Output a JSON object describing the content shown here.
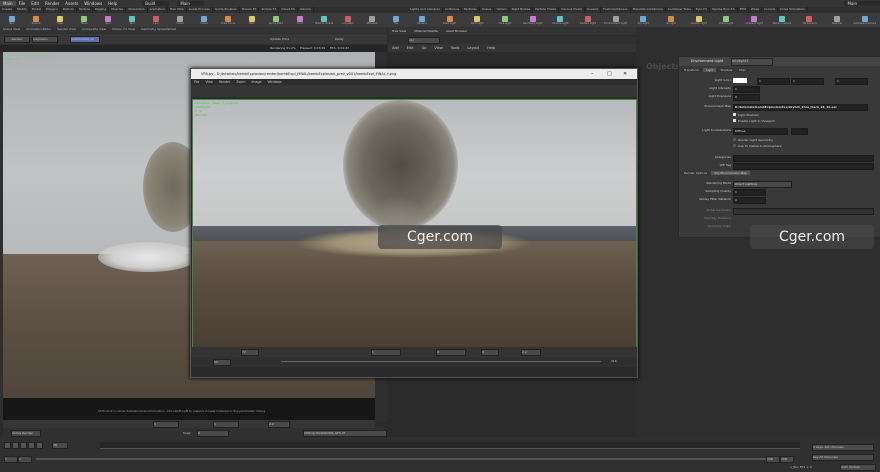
{
  "menubar": {
    "items": [
      "Main",
      "File",
      "Edit",
      "Render",
      "Assets",
      "Windows",
      "Help",
      "Build",
      "Main"
    ],
    "desktop": "Main"
  },
  "shelf": {
    "tabs": [
      "Create",
      "Modify",
      "Model",
      "Polygon",
      "Deform",
      "Texture",
      "Rigging",
      "Muscles",
      "Characters",
      "Animation",
      "Hair Utils",
      "Guide Process",
      "Guide Brushes",
      "Terrain FX",
      "Simple FX",
      "Cloud FX",
      "Volume"
    ],
    "tools": [
      "Box",
      "Sphere",
      "Tube",
      "Torus",
      "Grid",
      "Null",
      "Line",
      "Circle",
      "Curve",
      "Draw Curve",
      "Path",
      "Spray Paint",
      "Font",
      "Platonic Solids",
      "L-System",
      "Metaball",
      "File"
    ]
  },
  "lights_shelf": {
    "tabs": [
      "Lights and Cameras",
      "Collisions",
      "Particles",
      "Grains",
      "Vellum",
      "Rigid Bodies",
      "Particle Fluids",
      "Viscous Fluids",
      "Oceans",
      "Fluid Containers",
      "Populate Containers",
      "Container Tools",
      "Pyro FX",
      "Sparse Pyro FX",
      "FEM",
      "Wires",
      "Crowds",
      "Drive Simulation"
    ],
    "tools": [
      "Camera",
      "Point Light",
      "Spot Light",
      "Area Light",
      "Geometry Light",
      "Volume Light",
      "Distant Light",
      "Environment Light",
      "Sky Light",
      "GI Light",
      "Caustic Light",
      "Portal Light",
      "Ambient Light",
      "Stereo Camera",
      "VR Camera",
      "Switcher",
      "Gamepad Camera"
    ]
  },
  "left_viewer": {
    "tabs": [
      "Scene View",
      "Animation Editor",
      "Render View",
      "Composite View",
      "Motion FX View",
      "Geometry Spreadsheet"
    ],
    "render_button": "Render",
    "camera": "/obj/cam1",
    "renderer": "/out/mantra_ipr",
    "update_time": "Update Time",
    "delay": "Delay",
    "progress": "Rendering 61.2%",
    "elapsed": "Elapsed: 0:03:29",
    "eta": "ETA: 0:04:47",
    "memory": "Memory:",
    "memory_val": "1.00 GB",
    "overlay_title": "/obj/vray_rop1 [V-Ray] (3:17:03)",
    "overlay_res": "1280x720",
    "overlay_frame": "fr 1",
    "status_hint": "Shift-click to show detailed pixel information. Ctrl+Shift-Left to inspect closest material in the parameter dialog",
    "frame_field": "1",
    "zoom_field": "1",
    "snap": "Snap",
    "snap_val": "6",
    "output_path": "$HIP/ipr/SideWallbS_GFX.tif",
    "active_render": "Active Render"
  },
  "vfb": {
    "title": "VFB.py - D:/tutorials/bombExplosion/render/bombExpl_FINAL/bombExplosion_prev_v001/bombExpl_FINAL.*.png",
    "menu": [
      "File",
      "View",
      "Render",
      "Zoom",
      "Image",
      "Windows"
    ],
    "overlay_file": "bombExpl_FINAL_[F].png[72]",
    "overlay_res": "1280x720",
    "overlay_frame": "fr 72",
    "overlay_num": "48/1000",
    "frame": "72",
    "frame2": "24",
    "range_end": "216",
    "gamma": "2.2",
    "exposure_val": "0",
    "field_a": "1",
    "field_b": "0",
    "field_c": "0"
  },
  "network": {
    "tabs": [
      "Tree View",
      "Material Palette",
      "Asset Browser"
    ],
    "path": "obj",
    "menu": [
      "Add",
      "Edit",
      "Go",
      "View",
      "Tools",
      "Layout",
      "Help"
    ],
    "label": "Objects"
  },
  "params": {
    "node_type": "Environment Light",
    "node_name": "envlight1",
    "tabs": [
      "Transform",
      "Light",
      "Shadow",
      "Misc"
    ],
    "light_color_label": "Light Color",
    "light_color_vals": [
      "1",
      "1",
      "1"
    ],
    "intensity_label": "Light Intensity",
    "intensity": "1",
    "exposure_label": "Light Exposure",
    "exposure": "0",
    "envmap_label": "Environment Map",
    "envmap": "D:/tutorials/bombExplosion/tex/skyhdr_khm_track_01_4k.exr",
    "light_enabled": "Light Enabled",
    "enable_viewport": "Enable Light In Viewport",
    "contributions_label": "Light Contributions",
    "contrib": "Diffuse",
    "render_geo": "Render Light Geometry",
    "cap_visible": "Cap To Visible In Atmosphere",
    "categories_label": "Categories",
    "lpe_label": "LPE Tag",
    "sub_tabs": [
      "Render Options",
      "Sky Environment Map"
    ],
    "rendering_mode_label": "Rendering Mode",
    "rendering_mode": "Direct Lighting",
    "sampling_quality_label": "Sampling Quality",
    "sampling_quality": "1",
    "filter_label": "Glossy Filter Network",
    "filter_val": "0",
    "portal_label": "Portal Geometry",
    "max_distance_label": "Max Ray Distance",
    "sampling_angle_label": "Sampling Angle"
  },
  "watermarks": [
    "Cger.com",
    "Cger.com"
  ],
  "timeline": {
    "frame": "48",
    "start": "1",
    "end": "108",
    "start2": "1",
    "end2": "108",
    "keys": "0 keys, 0/0 channels",
    "key_all": "Key All Channels",
    "auto_update": "Auto Update",
    "frame_label": "x_fps: F01 + 3"
  }
}
